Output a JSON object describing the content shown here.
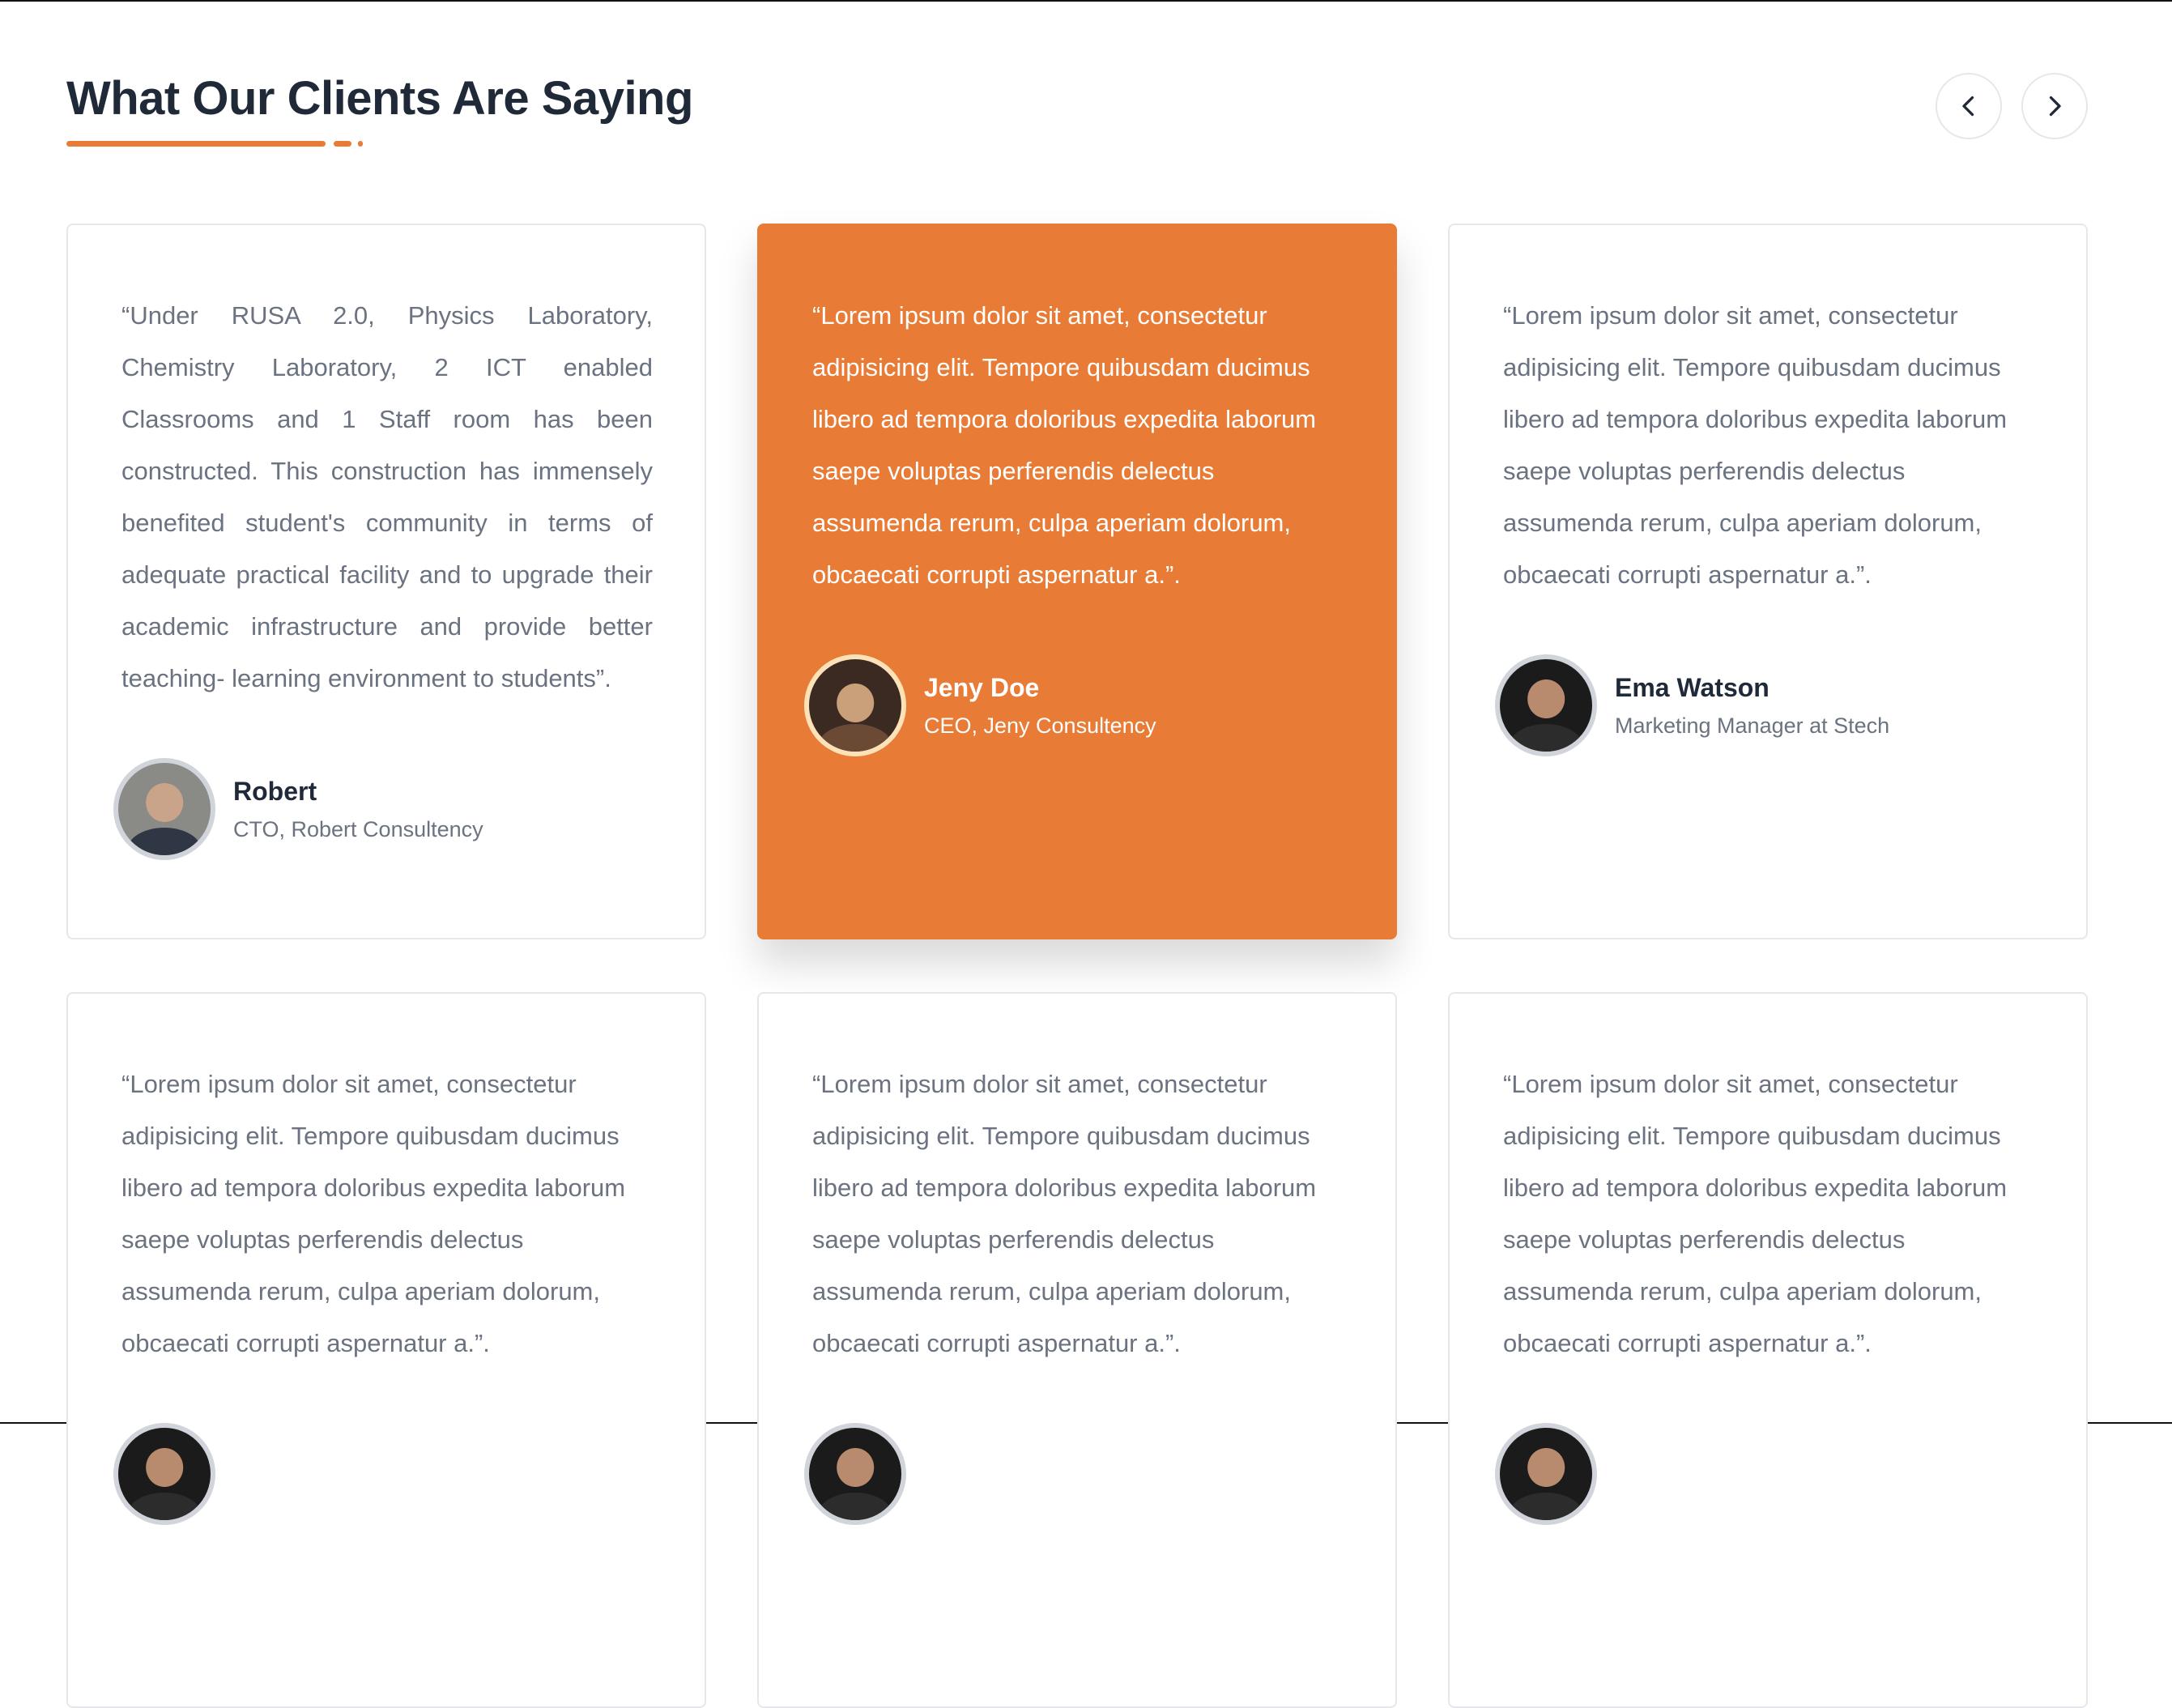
{
  "header": {
    "title": "What Our Clients Are Saying"
  },
  "nav": {
    "prev_icon": "chevron-left-icon",
    "next_icon": "chevron-right-icon"
  },
  "colors": {
    "accent": "#e87b35"
  },
  "testimonials": [
    {
      "quote": "“Under RUSA 2.0, Physics Laboratory, Chemistry Laboratory, 2 ICT enabled Classrooms and 1 Staff room has been constructed. This construction has immensely benefited student's community in terms of adequate practical facility and to upgrade their academic infrastructure and provide better teaching- learning environment to students”.",
      "name": "Robert",
      "role": "CTO, Robert Consultency"
    },
    {
      "quote": "“Lorem ipsum dolor sit amet, consectetur adipisicing elit. Tempore quibusdam ducimus libero ad tempora doloribus expedita laborum saepe voluptas perferendis delectus assumenda rerum, culpa aperiam dolorum, obcaecati corrupti aspernatur a.”.",
      "name": "Jeny Doe",
      "role": "CEO, Jeny Consultency"
    },
    {
      "quote": "“Lorem ipsum dolor sit amet, consectetur adipisicing elit. Tempore quibusdam ducimus libero ad tempora doloribus expedita laborum saepe voluptas perferendis delectus assumenda rerum, culpa aperiam dolorum, obcaecati corrupti aspernatur a.”.",
      "name": "Ema Watson",
      "role": "Marketing Manager at Stech"
    },
    {
      "quote": "“Lorem ipsum dolor sit amet, consectetur adipisicing elit. Tempore quibusdam ducimus libero ad tempora doloribus expedita laborum saepe voluptas perferendis delectus assumenda rerum, culpa aperiam dolorum, obcaecati corrupti aspernatur a.”."
    },
    {
      "quote": "“Lorem ipsum dolor sit amet, consectetur adipisicing elit. Tempore quibusdam ducimus libero ad tempora doloribus expedita laborum saepe voluptas perferendis delectus assumenda rerum, culpa aperiam dolorum, obcaecati corrupti aspernatur a.”."
    },
    {
      "quote": "“Lorem ipsum dolor sit amet, consectetur adipisicing elit. Tempore quibusdam ducimus libero ad tempora doloribus expedita laborum saepe voluptas perferendis delectus assumenda rerum, culpa aperiam dolorum, obcaecati corrupti aspernatur a.”."
    }
  ]
}
